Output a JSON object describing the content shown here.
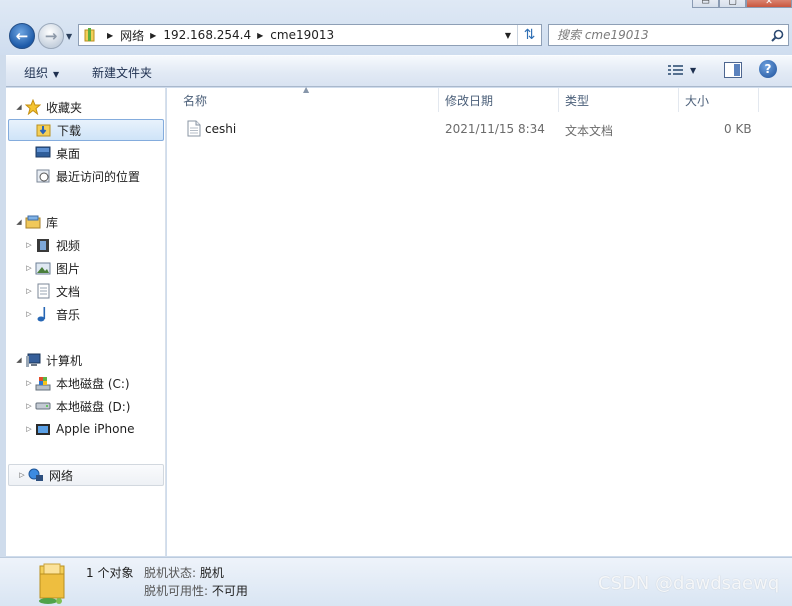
{
  "window": {
    "controls": {
      "minimize": "▭",
      "maximize": "▢",
      "close": "✕"
    }
  },
  "address_bar": {
    "crumbs": [
      "网络",
      "192.168.254.4",
      "cme19013"
    ],
    "refresh_icon": "refresh-arrows-icon"
  },
  "search": {
    "placeholder": "搜索 cme19013"
  },
  "command_bar": {
    "organize": "组织",
    "new_folder": "新建文件夹",
    "help": "?"
  },
  "nav": {
    "favorites": {
      "label": "收藏夹",
      "items": [
        "下载",
        "桌面",
        "最近访问的位置"
      ]
    },
    "libraries": {
      "label": "库",
      "items": [
        "视频",
        "图片",
        "文档",
        "音乐"
      ]
    },
    "computer": {
      "label": "计算机",
      "items": [
        "本地磁盘 (C:)",
        "本地磁盘 (D:)",
        "Apple iPhone"
      ]
    },
    "network": {
      "label": "网络"
    }
  },
  "columns": [
    "名称",
    "修改日期",
    "类型",
    "大小"
  ],
  "files": [
    {
      "name": "ceshi",
      "modified": "2021/11/15 8:34",
      "type": "文本文档",
      "size": "0 KB"
    }
  ],
  "status": {
    "count": "1 个对象",
    "offline_status_label": "脱机状态:",
    "offline_status_value": "脱机",
    "offline_avail_label": "脱机可用性:",
    "offline_avail_value": "不可用"
  },
  "watermark": "CSDN @dawdsaewq",
  "colors": {
    "accent": "#1d5aa8",
    "selection": "#cfe4f8",
    "background": "#cfdcec"
  }
}
